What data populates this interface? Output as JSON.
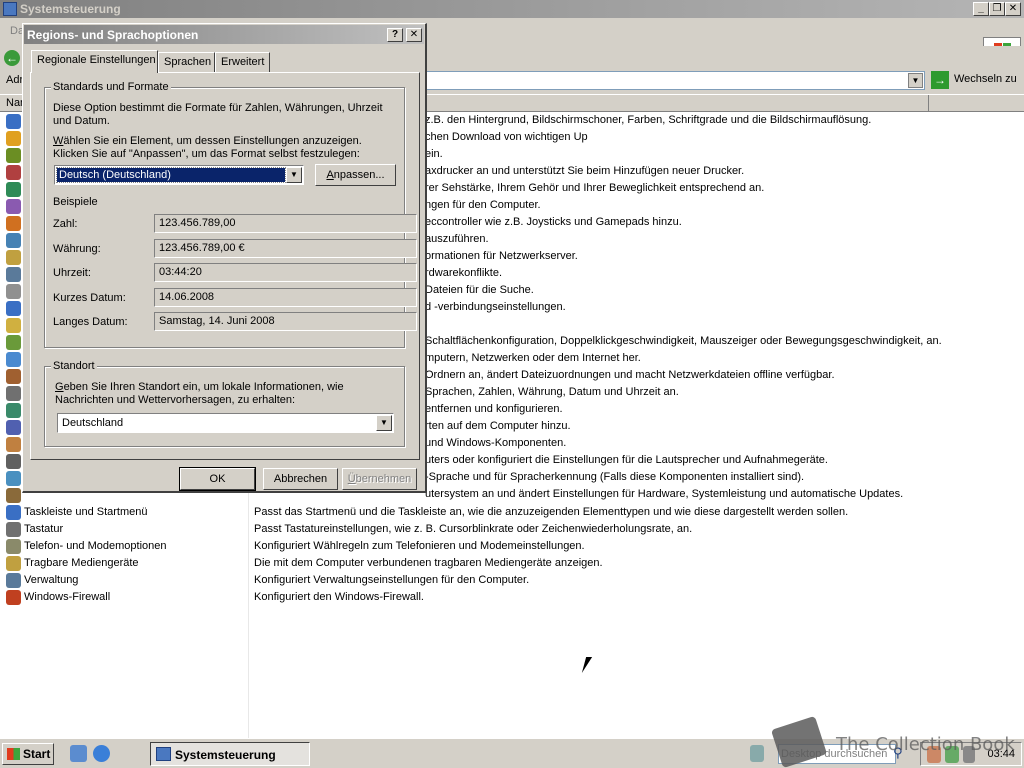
{
  "window": {
    "title": "Systemsteuerung"
  },
  "menubar": {
    "first_item": "Da"
  },
  "address": {
    "label": "Adr",
    "go_label": "Wechseln zu"
  },
  "list": {
    "header_name": "Nam",
    "partial_descriptions": [
      "z.B. den Hintergrund, Bildschirmschoner, Farben, Schriftgrade und die Bildschirmauflösung.",
      "chen Download von wichtigen Up",
      "ein.",
      "axdrucker an und unterstützt Sie beim Hinzufügen neuer Drucker.",
      "rer Sehstärke, Ihrem Gehör und Ihrer Beweglichkeit entsprechend an.",
      "ngen für den Computer.",
      "eccontroller wie z.B. Joysticks und Gamepads hinzu.",
      "auszuführen.",
      "ormationen für Netzwerkserver.",
      "rdwarekonflikte.",
      "Dateien für die Suche.",
      "d -verbindungseinstellungen.",
      "",
      "Schaltflächenkonfiguration, Doppelklickgeschwindigkeit, Mauszeiger oder Bewegungsgeschwindigkeit, an.",
      "mputern, Netzwerken oder dem Internet her.",
      "Ordnern an, ändert Dateizuordnungen und macht Netzwerkdateien offline verfügbar.",
      "Sprachen, Zahlen, Währung, Datum und Uhrzeit an.",
      "entfernen und konfigurieren.",
      "rten auf dem Computer hinzu.",
      "und Windows-Komponenten.",
      "uters oder konfiguriert die Einstellungen für die Lautsprecher und Aufnahmegeräte.",
      "-Sprache und für Spracherkennung (Falls diese Komponenten installiert sind).",
      "utersystem an und ändert Einstellungen für Hardware, Systemleistung und automatische Updates."
    ],
    "items": [
      {
        "name": "Taskleiste und Startmenü",
        "desc": "Passt das Startmenü und die Taskleiste an, wie die anzuzeigenden Elementtypen und wie diese dargestellt werden sollen."
      },
      {
        "name": "Tastatur",
        "desc": "Passt Tastatureinstellungen, wie z. B. Cursorblinkrate oder Zeichenwiederholungsrate, an."
      },
      {
        "name": "Telefon- und Modemoptionen",
        "desc": "Konfiguriert Wählregeln zum Telefonieren und Modemeinstellungen."
      },
      {
        "name": "Tragbare Mediengeräte",
        "desc": "Die mit dem Computer verbundenen tragbaren Mediengeräte anzeigen."
      },
      {
        "name": "Verwaltung",
        "desc": "Konfiguriert Verwaltungseinstellungen für den Computer."
      },
      {
        "name": "Windows-Firewall",
        "desc": "Konfiguriert den Windows-Firewall."
      }
    ]
  },
  "dialog": {
    "title": "Regions- und Sprachoptionen",
    "help_btn": "?",
    "close_btn": "✕",
    "tabs": [
      "Regionale Einstellungen",
      "Sprachen",
      "Erweitert"
    ],
    "standards": {
      "title": "Standards und Formate",
      "desc": "Diese Option bestimmt die Formate für Zahlen, Währungen, Uhrzeit und Datum.",
      "select_hint_prefix": "",
      "select_hint_accel": "W",
      "select_hint_rest": "ählen Sie ein Element, um dessen Einstellungen anzuzeigen. Klicken Sie auf \"Anpassen\", um das Format selbst festzulegen:",
      "selected_format": "Deutsch (Deutschland)",
      "customize_accel": "A",
      "customize_rest": "npassen...",
      "examples_title": "Beispiele",
      "examples": [
        {
          "label": "Zahl:",
          "value": "123.456.789,00"
        },
        {
          "label": "Währung:",
          "value": "123.456.789,00 €"
        },
        {
          "label": "Uhrzeit:",
          "value": "03:44:20"
        },
        {
          "label": "Kurzes Datum:",
          "value": "14.06.2008"
        },
        {
          "label": "Langes Datum:",
          "value": "Samstag, 14. Juni 2008"
        }
      ]
    },
    "location": {
      "title": "Standort",
      "desc_accel": "G",
      "desc_rest": "eben Sie Ihren Standort ein, um lokale Informationen, wie Nachrichten und Wettervorhersagen, zu erhalten:",
      "value": "Deutschland"
    },
    "ok": "OK",
    "cancel": "Abbrechen",
    "apply_accel": "Ü",
    "apply_rest": "bernehmen"
  },
  "taskbar": {
    "start": "Start",
    "task": "Systemsteuerung",
    "search_placeholder": "Desktop durchsuchen",
    "clock": "03:44"
  },
  "watermark": "The Collection Book",
  "colors": {
    "selection": "#0a246a",
    "titlebar_inactive": "#808080"
  }
}
